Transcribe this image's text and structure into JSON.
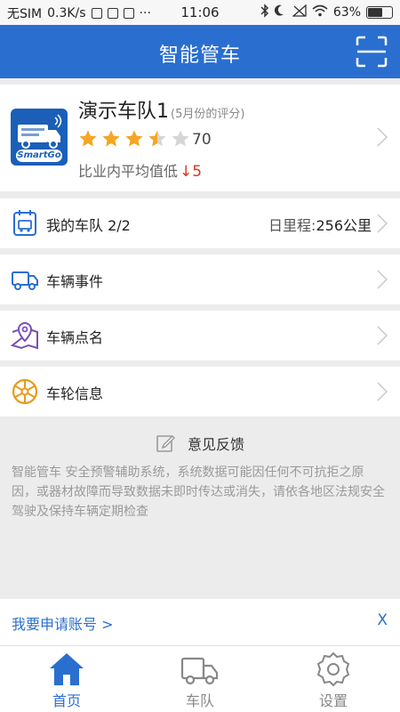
{
  "status_bar": {
    "carrier": "无SIM",
    "speed": "0.3K/s",
    "time": "11:06",
    "battery": "63%",
    "battery_level": 0.63
  },
  "app_bar": {
    "title": "智能管车",
    "scan_icon": "scan-icon"
  },
  "fleet": {
    "name": "演示车队1",
    "rating_note": "(5月份的评分)",
    "rating_stars": 3.5,
    "score": "70",
    "compare_label": "比业内平均值低",
    "compare_delta": "↓5",
    "logo_text": "SmartGo"
  },
  "menu": {
    "my_fleet": {
      "label": "我的车队 2/2",
      "right_label": "日里程:",
      "right_value": "256公里"
    },
    "vehicle_events": {
      "label": "车辆事件"
    },
    "vehicle_rollcall": {
      "label": "车辆点名"
    },
    "wheel_info": {
      "label": "车轮信息"
    }
  },
  "feedback": {
    "label": "意见反馈",
    "disclaimer": "智能管车 安全预警辅助系统，系统数据可能因任何不可抗拒之原因，或器材故障而导致数据未即时传达或消失，请依各地区法规安全驾驶及保持车辆定期检查"
  },
  "apply_bar": {
    "link": "我要申请账号 >",
    "close": "X"
  },
  "tabs": [
    {
      "label": "首页",
      "icon": "home-icon",
      "active": true
    },
    {
      "label": "车队",
      "icon": "truck-icon",
      "active": false
    },
    {
      "label": "设置",
      "icon": "gear-icon",
      "active": false
    }
  ],
  "colors": {
    "primary": "#2a6fd0",
    "star": "#f5a623",
    "warn": "#d8341f",
    "inactive": "#888888"
  }
}
